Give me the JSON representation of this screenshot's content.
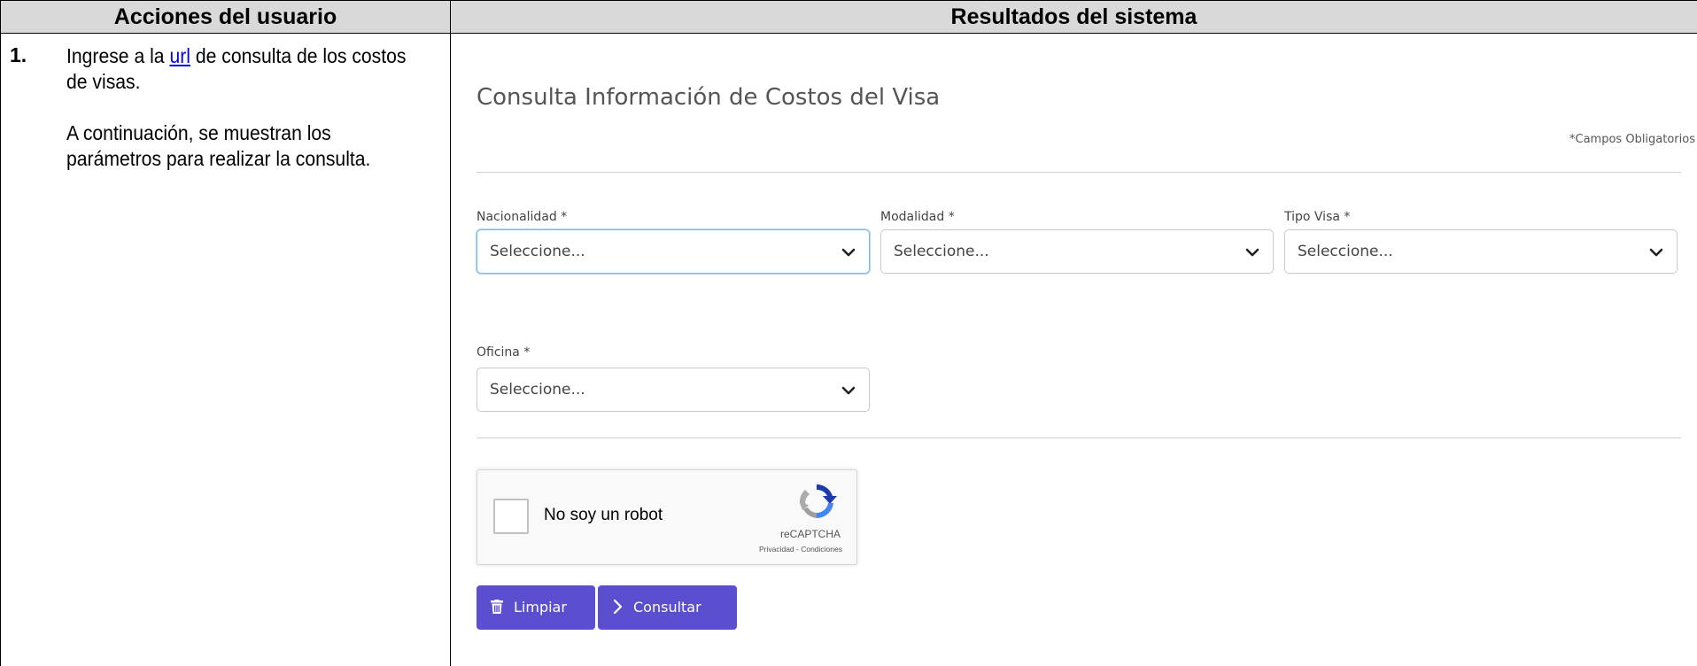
{
  "table": {
    "header_left": "Acciones del usuario",
    "header_right": "Resultados del sistema"
  },
  "step": {
    "number": "1.",
    "line1_before_link": "Ingrese a la ",
    "link_text": "url",
    "line1_after_link": " de consulta de los costos de visas.",
    "line2": "A continuación, se muestran los parámetros para realizar la consulta."
  },
  "form": {
    "title": "Consulta Información de Costos del Visa",
    "required_note": "*Campos Obligatorios",
    "fields": [
      {
        "label": "Nacionalidad",
        "required_mark": "*",
        "value": "Seleccione..."
      },
      {
        "label": "Modalidad",
        "required_mark": "*",
        "value": "Seleccione..."
      },
      {
        "label": "Tipo Visa",
        "required_mark": "*",
        "value": "Seleccione..."
      },
      {
        "label": "Oficina",
        "required_mark": "*",
        "value": "Seleccione..."
      }
    ]
  },
  "captcha": {
    "label": "No soy un robot",
    "brand": "reCAPTCHA",
    "links": "Privacidad - Condiciones"
  },
  "buttons": {
    "clear_label": "Limpiar",
    "query_label": "Consultar"
  },
  "colors": {
    "button_bg": "#5b4fcf",
    "header_bg": "#d9d9d9",
    "focus_border": "#7fb8e6",
    "link": "#0000ee"
  },
  "icons": [
    "chevron-down-icon",
    "trash-icon",
    "chevron-right-icon",
    "recaptcha-logo-icon"
  ]
}
